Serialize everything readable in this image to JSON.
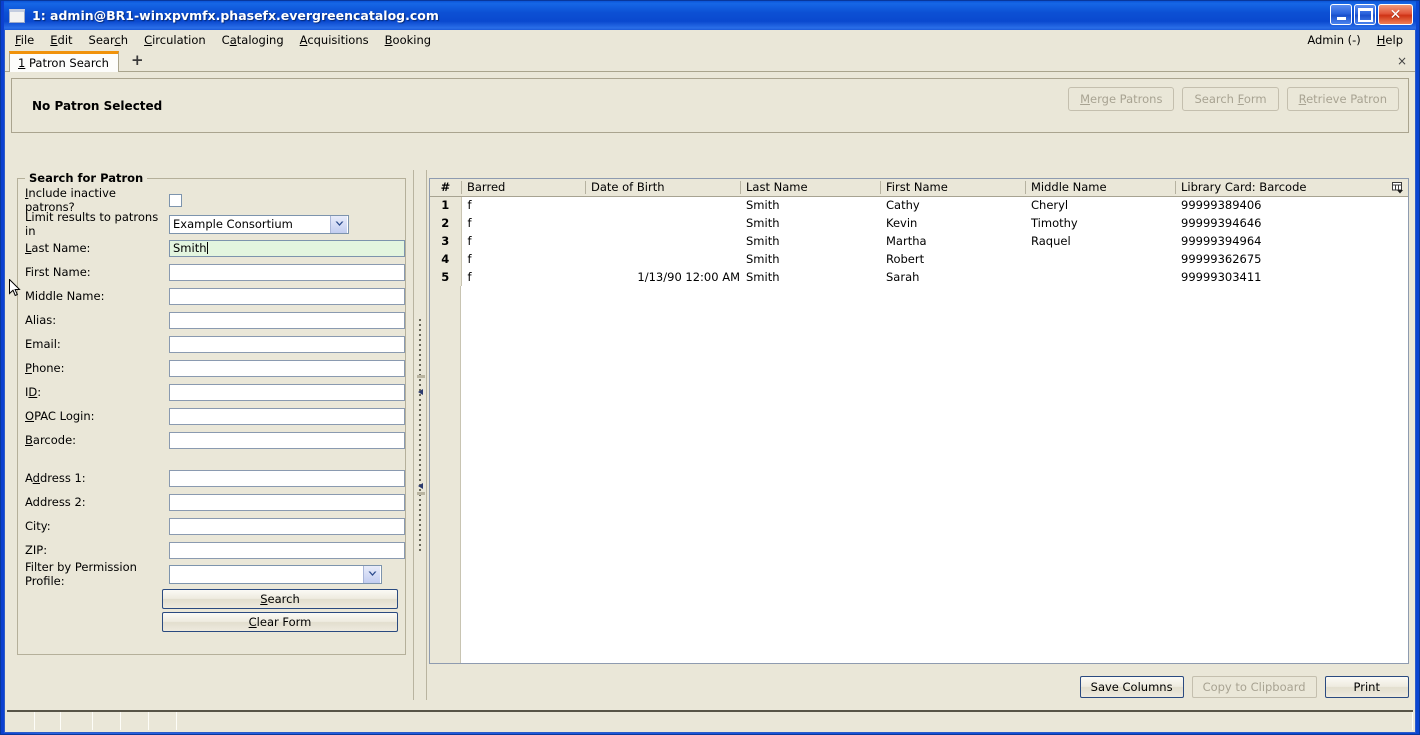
{
  "window": {
    "title": "1: admin@BR1-winxpvmfx.phasefx.evergreencatalog.com",
    "icon": "window-icon",
    "minimize": "minimize-icon",
    "maximize": "maximize-icon",
    "close": "✕"
  },
  "menu": {
    "items": [
      {
        "label": "File",
        "accel": "F"
      },
      {
        "label": "Edit",
        "accel": "E"
      },
      {
        "label": "Search",
        "accel": "c"
      },
      {
        "label": "Circulation",
        "accel": "C"
      },
      {
        "label": "Cataloging",
        "accel": "a"
      },
      {
        "label": "Acquisitions",
        "accel": "A"
      },
      {
        "label": "Booking",
        "accel": "B"
      }
    ],
    "right": [
      {
        "label": "Admin (-)",
        "accel": ""
      },
      {
        "label": "Help",
        "accel": "H"
      }
    ]
  },
  "tabs": {
    "active": {
      "number": "1",
      "label": "Patron Search"
    },
    "new_tab_label": "+",
    "close_label": "×"
  },
  "patron_header": {
    "status": "No Patron Selected",
    "buttons": [
      {
        "label": "Merge Patrons",
        "accel": "M",
        "enabled": false
      },
      {
        "label": "Search Form",
        "accel": "F",
        "enabled": false
      },
      {
        "label": "Retrieve Patron",
        "accel": "R",
        "enabled": false
      }
    ]
  },
  "search_form": {
    "legend": "Search for Patron",
    "include_inactive": {
      "label": "Include inactive patrons?",
      "accel": "I",
      "checked": false
    },
    "limit_results": {
      "label": "Limit results to patrons in",
      "value": "Example Consortium"
    },
    "fields": [
      {
        "label": "Last Name:",
        "accel": "L",
        "value": "Smith",
        "focused": true
      },
      {
        "label": "First Name:",
        "accel": "",
        "value": "",
        "focused": false
      },
      {
        "label": "Middle Name:",
        "accel": "",
        "value": "",
        "focused": false
      },
      {
        "label": "Alias:",
        "accel": "",
        "value": "",
        "focused": false
      },
      {
        "label": "Email:",
        "accel": "",
        "value": "",
        "focused": false
      },
      {
        "label": "Phone:",
        "accel": "P",
        "value": "",
        "focused": false
      },
      {
        "label": "ID:",
        "accel": "D",
        "value": "",
        "focused": false
      },
      {
        "label": "OPAC Login:",
        "accel": "O",
        "value": "",
        "focused": false
      },
      {
        "label": "Barcode:",
        "accel": "B",
        "value": "",
        "focused": false
      }
    ],
    "address_fields": [
      {
        "label": "Address 1:",
        "accel": "d",
        "value": "",
        "focused": false
      },
      {
        "label": "Address 2:",
        "accel": "",
        "value": "",
        "focused": false
      },
      {
        "label": "City:",
        "accel": "",
        "value": "",
        "focused": false
      },
      {
        "label": "ZIP:",
        "accel": "",
        "value": "",
        "focused": false
      }
    ],
    "permission_profile": {
      "label": "Filter by Permission Profile:",
      "value": ""
    },
    "search_button": {
      "label": "Search",
      "accel": "S"
    },
    "clear_button": {
      "label": "Clear Form",
      "accel": "C"
    }
  },
  "results": {
    "columns": [
      "#",
      "Barred",
      "Date of Birth",
      "Last Name",
      "First Name",
      "Middle Name",
      "Library Card: Barcode"
    ],
    "column_picker": "column-picker-icon",
    "rows": [
      {
        "num": "1",
        "barred": "f",
        "dob": "",
        "last": "Smith",
        "first": "Cathy",
        "middle": "Cheryl",
        "barcode": "99999389406"
      },
      {
        "num": "2",
        "barred": "f",
        "dob": "",
        "last": "Smith",
        "first": "Kevin",
        "middle": "Timothy",
        "barcode": "99999394646"
      },
      {
        "num": "3",
        "barred": "f",
        "dob": "",
        "last": "Smith",
        "first": "Martha",
        "middle": "Raquel",
        "barcode": "99999394964"
      },
      {
        "num": "4",
        "barred": "f",
        "dob": "",
        "last": "Smith",
        "first": "Robert",
        "middle": "",
        "barcode": "99999362675"
      },
      {
        "num": "5",
        "barred": "f",
        "dob": "1/13/90 12:00 AM",
        "last": "Smith",
        "first": "Sarah",
        "middle": "",
        "barcode": "99999303411"
      }
    ],
    "buttons": [
      {
        "label": "Save Columns",
        "enabled": true
      },
      {
        "label": "Copy to Clipboard",
        "enabled": false
      },
      {
        "label": "Print",
        "enabled": true
      }
    ]
  },
  "status_bar": {
    "panes": [
      "",
      "",
      "",
      "",
      "",
      "",
      ""
    ]
  },
  "colors": {
    "window_chrome": "#0a46d2",
    "client_bg": "#eae7d8",
    "field_bg": "#ffffff",
    "focused_field_bg": "#e3f5df",
    "tab_accent": "#f0920a",
    "button_border": "#2a4a80",
    "disabled_text": "#a8a392"
  }
}
